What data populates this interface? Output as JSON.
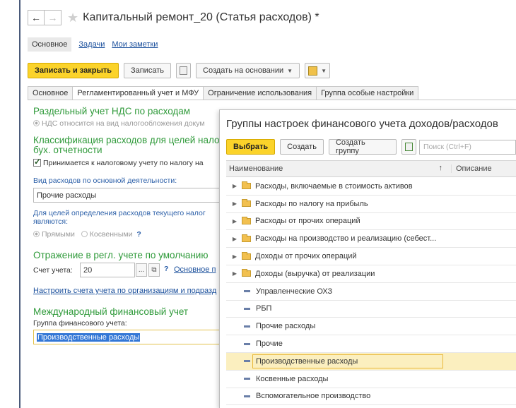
{
  "window": {
    "title": "Капитальный ремонт_20 (Статья расходов) *",
    "back_icon": "←",
    "forward_icon": "→",
    "star_icon": "★"
  },
  "nav": {
    "current": "Основное",
    "links": [
      "Задачи",
      "Мои заметки"
    ]
  },
  "toolbar": {
    "save_close": "Записать и закрыть",
    "save": "Записать",
    "create_based": "Создать на основании"
  },
  "form_tabs": [
    "Основное",
    "Регламентированный учет и МФУ",
    "Ограничение использования",
    "Группа особые настройки"
  ],
  "form": {
    "vat_section": "Раздельный учет НДС по расходам",
    "vat_option": "НДС относится на вид налогообложения докум",
    "classification_section_line1": "Классификация расходов для целей нало",
    "classification_section_line2": "бух. отчетности",
    "tax_checkbox": "Принимается к налоговому учету по налогу на",
    "expense_kind_label": "Вид расходов по основной деятельности:",
    "expense_kind_value": "Прочие расходы",
    "current_costs_label_line1": "Для целей определения расходов текущего налог",
    "current_costs_label_line2": "являются:",
    "radio_direct": "Прямыми",
    "radio_indirect": "Косвенными",
    "help": "?",
    "reflection_section": "Отражение в регл. учете по умолчанию",
    "account_label": "Счет учета:",
    "account_value": "20",
    "account_link": "Основное п",
    "configure_link": "Настроить счета учета по организациям и подразд",
    "ifrs_section": "Международный финансовый учет",
    "ifrs_group_label": "Группа финансового учета:",
    "ifrs_group_value": "Производственные расходы"
  },
  "popup": {
    "title": "Группы настроек финансового учета доходов/расходов",
    "select_btn": "Выбрать",
    "create_btn": "Создать",
    "create_group_btn": "Создать группу",
    "search_placeholder": "Поиск (Ctrl+F)",
    "col_name": "Наименование",
    "sort_arrow": "↑",
    "col_desc": "Описание",
    "folders": [
      "Расходы, включаемые в стоимость активов",
      "Расходы по налогу на прибыль",
      "Расходы от прочих операций",
      "Расходы на производство и реализацию (себест...",
      "Доходы от прочих операций",
      "Доходы (выручка) от реализации"
    ],
    "items": [
      "Управленческие ОХЗ",
      "РБП",
      "Прочие расходы",
      "Прочие",
      "Производственные расходы",
      "Косвенные расходы",
      "Вспомогательное производство"
    ],
    "selected_item": "Производственные расходы"
  }
}
